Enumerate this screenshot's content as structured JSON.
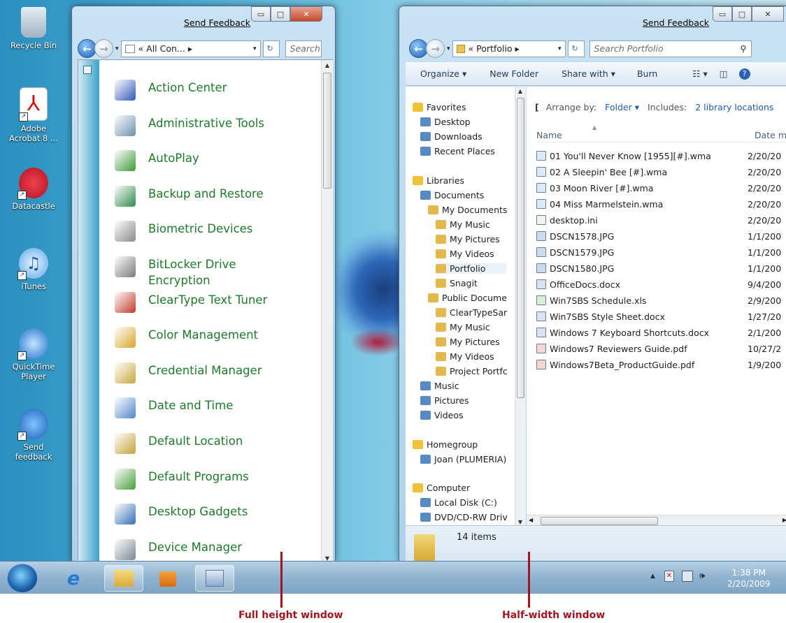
{
  "desktop": {
    "icons": [
      {
        "label": "Recycle Bin"
      },
      {
        "label": "Adobe Acrobat 8 ..."
      },
      {
        "label": "Datacastle"
      },
      {
        "label": "iTunes"
      },
      {
        "label": "QuickTime Player"
      },
      {
        "label": "Send feedback"
      }
    ]
  },
  "left_window": {
    "feedback": "Send Feedback",
    "address": "« All Con... ▸",
    "search_placeholder": "Search",
    "items": [
      {
        "label": "Action Center",
        "icon": "flag-icon"
      },
      {
        "label": "Administrative Tools",
        "icon": "admin-tools-icon"
      },
      {
        "label": "AutoPlay",
        "icon": "autoplay-icon"
      },
      {
        "label": "Backup and Restore",
        "icon": "backup-icon"
      },
      {
        "label": "Biometric Devices",
        "icon": "fingerprint-icon"
      },
      {
        "label": "BitLocker Drive Encryption",
        "icon": "bitlocker-icon"
      },
      {
        "label": "ClearType Text Tuner",
        "icon": "cleartype-icon"
      },
      {
        "label": "Color Management",
        "icon": "color-icon"
      },
      {
        "label": "Credential Manager",
        "icon": "vault-icon"
      },
      {
        "label": "Date and Time",
        "icon": "calendar-icon"
      },
      {
        "label": "Default Location",
        "icon": "location-icon"
      },
      {
        "label": "Default Programs",
        "icon": "programs-icon"
      },
      {
        "label": "Desktop Gadgets",
        "icon": "gadgets-icon"
      },
      {
        "label": "Device Manager",
        "icon": "device-manager-icon"
      }
    ]
  },
  "right_window": {
    "feedback": "Send Feedback",
    "address": "« Portfolio ▸",
    "search_placeholder": "Search Portfolio",
    "toolbar": {
      "organize": "Organize ▾",
      "new_folder": "New Folder",
      "share": "Share with ▾",
      "burn": "Burn"
    },
    "nav": [
      {
        "label": "Favorites",
        "indent": 0
      },
      {
        "label": "Desktop",
        "indent": 1
      },
      {
        "label": "Downloads",
        "indent": 1
      },
      {
        "label": "Recent Places",
        "indent": 1
      },
      {
        "label": "Libraries",
        "indent": 0
      },
      {
        "label": "Documents",
        "indent": 1
      },
      {
        "label": "My Documents",
        "indent": 2
      },
      {
        "label": "My Music",
        "indent": 3
      },
      {
        "label": "My Pictures",
        "indent": 3
      },
      {
        "label": "My Videos",
        "indent": 3
      },
      {
        "label": "Portfolio",
        "indent": 3
      },
      {
        "label": "Snagit",
        "indent": 3
      },
      {
        "label": "Public Docume",
        "indent": 2
      },
      {
        "label": "ClearTypeSar",
        "indent": 3
      },
      {
        "label": "My Music",
        "indent": 3
      },
      {
        "label": "My Pictures",
        "indent": 3
      },
      {
        "label": "My Videos",
        "indent": 3
      },
      {
        "label": "Project Portfc",
        "indent": 3
      },
      {
        "label": "Music",
        "indent": 1
      },
      {
        "label": "Pictures",
        "indent": 1
      },
      {
        "label": "Videos",
        "indent": 1
      },
      {
        "label": "Homegroup",
        "indent": 0
      },
      {
        "label": "Joan (PLUMERIA)",
        "indent": 1
      },
      {
        "label": "Computer",
        "indent": 0
      },
      {
        "label": "Local Disk (C:)",
        "indent": 1
      },
      {
        "label": "DVD/CD-RW Driv",
        "indent": 1
      }
    ],
    "library_bar": {
      "arrange_label": "Arrange by:",
      "arrange_value": "Folder ▾",
      "includes_label": "Includes:",
      "includes_value": "2 library locations"
    },
    "columns": {
      "name": "Name",
      "date": "Date m"
    },
    "files": [
      {
        "name": "01 You'll Never Know [1955][#].wma",
        "date": "2/20/20"
      },
      {
        "name": "02 A Sleepin' Bee [#].wma",
        "date": "2/20/20"
      },
      {
        "name": "03 Moon River [#].wma",
        "date": "2/20/20"
      },
      {
        "name": "04 Miss Marmelstein.wma",
        "date": "2/20/20"
      },
      {
        "name": "desktop.ini",
        "date": "2/20/20"
      },
      {
        "name": "DSCN1578.JPG",
        "date": "1/1/200"
      },
      {
        "name": "DSCN1579.JPG",
        "date": "1/1/200"
      },
      {
        "name": "DSCN1580.JPG",
        "date": "1/1/200"
      },
      {
        "name": "OfficeDocs.docx",
        "date": "9/4/200"
      },
      {
        "name": "Win7SBS Schedule.xls",
        "date": "2/9/200"
      },
      {
        "name": "Win7SBS Style Sheet.docx",
        "date": "1/27/20"
      },
      {
        "name": "Windows 7 Keyboard Shortcuts.docx",
        "date": "2/1/200"
      },
      {
        "name": "Windows7 Reviewers Guide.pdf",
        "date": "10/27/2"
      },
      {
        "name": "Windows7Beta_ProductGuide.pdf",
        "date": "1/9/200"
      }
    ],
    "details": "14 items"
  },
  "taskbar": {
    "time": "1:38 PM",
    "date": "2/20/2009"
  },
  "callouts": {
    "left": "Full height window",
    "right": "Half-width window"
  }
}
